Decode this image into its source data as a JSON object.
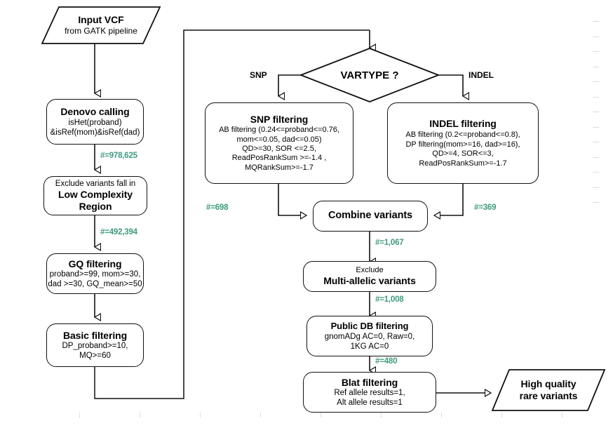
{
  "diagram": {
    "title": "De novo variant filtering pipeline flowchart",
    "accent_count_color": "#3d9c7e",
    "line_color": "#111111"
  },
  "nodes": {
    "input_vcf": {
      "title": "Input VCF",
      "subtitle": "from GATK pipeline",
      "shape": "parallelogram"
    },
    "denovo_calling": {
      "title": "Denovo calling",
      "line1": "isHet(proband)",
      "line2": "&isRef(mom)&isRef(dad)",
      "shape": "rounded-rect"
    },
    "low_complexity": {
      "top": "Exclude variants fall in",
      "title": "Low Complexity Region",
      "shape": "rounded-rect"
    },
    "gq_filtering": {
      "title": "GQ filtering",
      "line1": "proband>=99,  mom>=30,",
      "line2": "dad >=30, GQ_mean>=50",
      "shape": "rounded-rect"
    },
    "basic_filtering": {
      "title": "Basic filtering",
      "line1": "DP_proband>=10,",
      "line2": "MQ>=60",
      "shape": "rounded-rect"
    },
    "vartype": {
      "title": "VARTYPE ?",
      "shape": "diamond",
      "branch_left": "SNP",
      "branch_right": "INDEL"
    },
    "snp_filtering": {
      "title": "SNP filtering",
      "line1": "AB filtering (0.24<=proband<=0.76,",
      "line2": "mom<=0.05, dad<=0.05)",
      "line3": "QD>=30, SOR <=2.5,",
      "line4": "ReadPosRankSum >=-1.4 ,",
      "line5": "MQRankSum>=-1.7",
      "shape": "rounded-rect"
    },
    "indel_filtering": {
      "title": "INDEL filtering",
      "line1": "AB filtering (0.2<=proband<=0.8),",
      "line2": "DP filtering(mom>=16, dad>=16),",
      "line3": "QD>=4, SOR<=3,",
      "line4": "ReadPosRankSum>=-1.7",
      "shape": "rounded-rect"
    },
    "combine_variants": {
      "title": "Combine variants",
      "shape": "rounded-rect"
    },
    "multi_allelic": {
      "top": "Exclude",
      "title": "Multi-allelic variants",
      "shape": "rounded-rect"
    },
    "public_db": {
      "title": "Public DB filtering",
      "line1": "gnomADg AC=0, Raw=0,",
      "line2": "1KG AC=0",
      "shape": "rounded-rect"
    },
    "blat_filtering": {
      "title": "Blat filtering",
      "line1": "Ref allele results=1,",
      "line2": "Alt allele results=1",
      "shape": "rounded-rect"
    },
    "output": {
      "line1": "High quality",
      "line2": "rare variants",
      "shape": "parallelogram"
    }
  },
  "edge_counts": {
    "denovo_to_lcr": "#=978,625",
    "lcr_to_gq": "#=492,394",
    "snp_to_combine": "#=698",
    "indel_to_combine": "#=369",
    "combine_to_multiallelic": "#=1,067",
    "multiallelic_to_publicdb": "#=1,008",
    "publicdb_to_blat": "#=480"
  }
}
